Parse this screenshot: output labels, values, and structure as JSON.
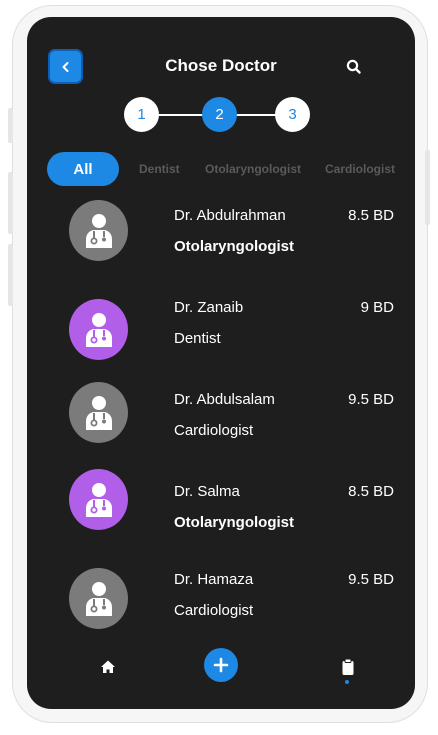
{
  "header": {
    "title": "Chose Doctor",
    "back_icon": "chevron-left-icon",
    "search_icon": "search-icon"
  },
  "stepper": {
    "steps": [
      {
        "label": "1",
        "state": "inactive"
      },
      {
        "label": "2",
        "state": "active"
      },
      {
        "label": "3",
        "state": "inactive"
      }
    ],
    "current_step": 2
  },
  "filters": {
    "chips": [
      "All",
      "Dentist",
      "Otolaryngologist",
      "Cardiologist"
    ],
    "selected": "All"
  },
  "doctors": [
    {
      "name": "Dr. Abdulrahman",
      "specialty": "Otolaryngologist",
      "price": "8.5 BD",
      "avatar_color": "#7b7b7b"
    },
    {
      "name": "Dr. Zanaib",
      "specialty": "Dentist",
      "price": "9 BD",
      "avatar_color": "#b15ee8"
    },
    {
      "name": "Dr. Abdulsalam",
      "specialty": "Cardiologist",
      "price": "9.5 BD",
      "avatar_color": "#7b7b7b"
    },
    {
      "name": "Dr. Salma",
      "specialty": "Otolaryngologist",
      "price": "8.5 BD",
      "avatar_color": "#b15ee8"
    },
    {
      "name": "Dr. Hamaza",
      "specialty": "Cardiologist",
      "price": "9.5 BD",
      "avatar_color": "#7b7b7b"
    }
  ],
  "bottom_nav": {
    "items": [
      "home-icon",
      "add-icon",
      "clipboard-icon"
    ],
    "active": "clipboard-icon"
  },
  "colors": {
    "accent": "#1e88e5",
    "background": "#1e1e1f",
    "avatar_gray": "#7b7b7b",
    "avatar_purple": "#b15ee8"
  }
}
